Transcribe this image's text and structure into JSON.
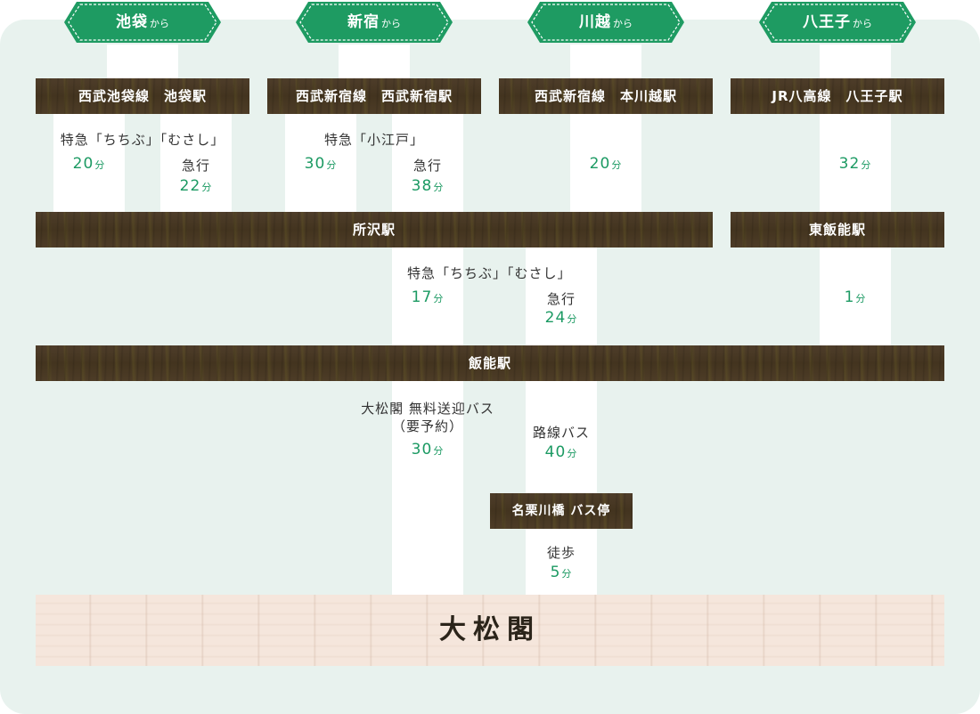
{
  "origins": [
    {
      "city": "池袋",
      "suffix": "から"
    },
    {
      "city": "新宿",
      "suffix": "から"
    },
    {
      "city": "川越",
      "suffix": "から"
    },
    {
      "city": "八王子",
      "suffix": "から"
    }
  ],
  "start_stations": [
    "西武池袋線　池袋駅",
    "西武新宿線　西武新宿駅",
    "西武新宿線　本川越駅",
    "JR八高線　八王子駅"
  ],
  "ikebukuro": {
    "service": "特急「ちちぶ」「むさし」",
    "ltd_time": "20",
    "express_label": "急行",
    "express_time": "22"
  },
  "shinjuku": {
    "service": "特急「小江戸」",
    "ltd_time": "30",
    "express_label": "急行",
    "express_time": "38"
  },
  "kawagoe": {
    "time": "20"
  },
  "hachioji": {
    "time": "32"
  },
  "tokorozawa": {
    "name": "所沢駅",
    "service": "特急「ちちぶ」「むさし」",
    "ltd_time": "17",
    "express_label": "急行",
    "express_time": "24"
  },
  "higashi_hanno": {
    "name": "東飯能駅",
    "time": "1"
  },
  "hanno": {
    "name": "飯能駅",
    "shuttle_line1": "大松閣 無料送迎バス",
    "shuttle_line2": "（要予約）",
    "shuttle_time": "30",
    "bus_label": "路線バス",
    "bus_time": "40"
  },
  "bus_stop": {
    "name": "名栗川橋 バス停",
    "walk_label": "徒歩",
    "walk_time": "5"
  },
  "unit": "分",
  "destination": "大松閣",
  "colors": {
    "green": "#1c9a63",
    "panel": "#e8f2ee",
    "bar": "#4a3a26",
    "destination_bg": "#f5e6dc"
  }
}
